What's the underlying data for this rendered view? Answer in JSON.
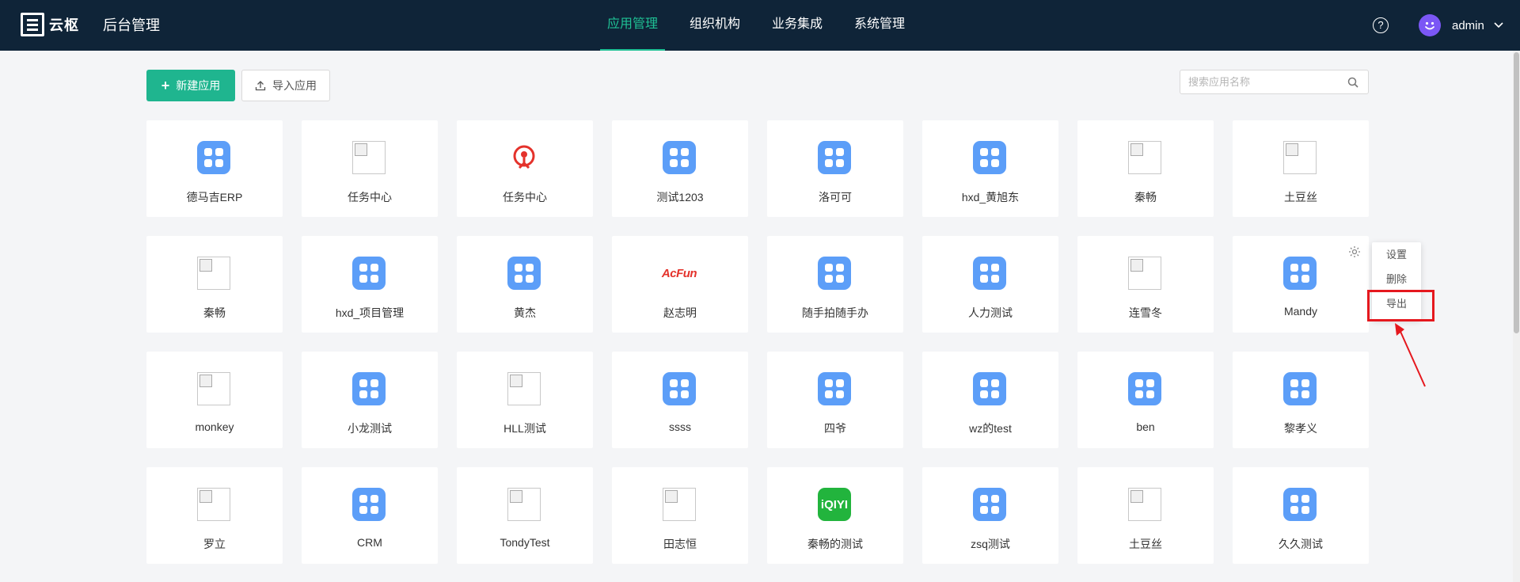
{
  "brand": {
    "name": "云枢",
    "title": "后台管理"
  },
  "nav": [
    {
      "label": "应用管理",
      "active": true
    },
    {
      "label": "组织机构",
      "active": false
    },
    {
      "label": "业务集成",
      "active": false
    },
    {
      "label": "系统管理",
      "active": false
    }
  ],
  "user": {
    "name": "admin"
  },
  "toolbar": {
    "new_label": "新建应用",
    "import_label": "导入应用"
  },
  "search": {
    "placeholder": "搜索应用名称"
  },
  "apps": [
    {
      "name": "德马吉ERP",
      "icon": "grid"
    },
    {
      "name": "任务中心",
      "icon": "broken"
    },
    {
      "name": "任务中心",
      "icon": "railway"
    },
    {
      "name": "测试1203",
      "icon": "grid"
    },
    {
      "name": "洛可可",
      "icon": "grid"
    },
    {
      "name": "hxd_黄旭东",
      "icon": "grid"
    },
    {
      "name": "秦畅",
      "icon": "broken"
    },
    {
      "name": "土豆丝",
      "icon": "broken"
    },
    {
      "name": "秦畅",
      "icon": "broken"
    },
    {
      "name": "hxd_项目管理",
      "icon": "grid"
    },
    {
      "name": "黄杰",
      "icon": "grid"
    },
    {
      "name": "赵志明",
      "icon": "acfun"
    },
    {
      "name": "随手拍随手办",
      "icon": "grid"
    },
    {
      "name": "人力测试",
      "icon": "grid"
    },
    {
      "name": "连雪冬",
      "icon": "broken"
    },
    {
      "name": "Mandy",
      "icon": "grid"
    },
    {
      "name": "monkey",
      "icon": "broken"
    },
    {
      "name": "小龙测试",
      "icon": "grid"
    },
    {
      "name": "HLL测试",
      "icon": "broken"
    },
    {
      "name": "ssss",
      "icon": "grid"
    },
    {
      "name": "四爷",
      "icon": "grid"
    },
    {
      "name": "wz的test",
      "icon": "grid"
    },
    {
      "name": "ben",
      "icon": "grid"
    },
    {
      "name": "黎孝义",
      "icon": "grid"
    },
    {
      "name": "罗立",
      "icon": "broken"
    },
    {
      "name": "CRM",
      "icon": "grid"
    },
    {
      "name": "TondyTest",
      "icon": "broken"
    },
    {
      "name": "田志恒",
      "icon": "broken"
    },
    {
      "name": "秦畅的测试",
      "icon": "iqiyi"
    },
    {
      "name": "zsq测试",
      "icon": "grid"
    },
    {
      "name": "土豆丝",
      "icon": "broken"
    },
    {
      "name": "久久测试",
      "icon": "grid"
    }
  ],
  "icon_text": {
    "acfun": "AcFun",
    "iqiyi": "iQIYI"
  },
  "dropdown": {
    "items": [
      "设置",
      "删除",
      "导出"
    ]
  },
  "colors": {
    "accent": "#1fb58f",
    "topbar": "#0f2438",
    "app_icon": "#5c9ef8",
    "highlight": "#e5181e"
  }
}
